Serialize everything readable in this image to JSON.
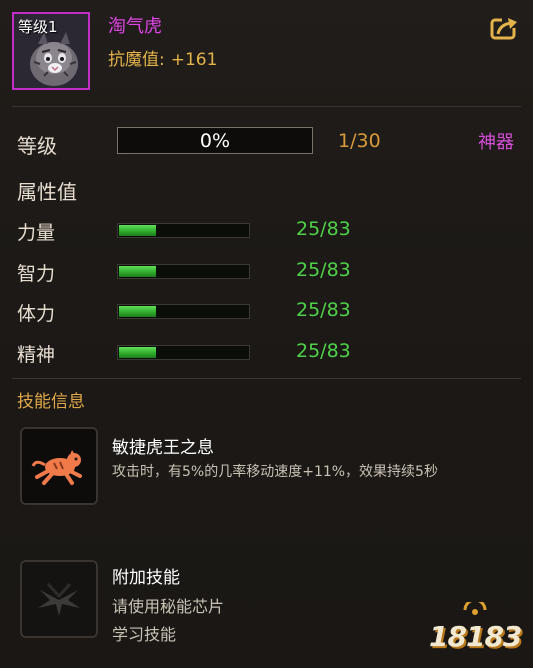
{
  "header": {
    "level_badge": "等级1",
    "pet_name": "淘气虎",
    "resist_label": "抗魔值:",
    "resist_value": "+161"
  },
  "level": {
    "label": "等级",
    "percent_text": "0%",
    "progress": 0,
    "count": "1/30",
    "artifact_label": "神器"
  },
  "attributes": {
    "title": "属性值",
    "items": [
      {
        "name": "力量",
        "value": "25/83",
        "fraction": 0.3
      },
      {
        "name": "智力",
        "value": "25/83",
        "fraction": 0.3
      },
      {
        "name": "体力",
        "value": "25/83",
        "fraction": 0.3
      },
      {
        "name": "精神",
        "value": "25/83",
        "fraction": 0.3
      }
    ]
  },
  "skills": {
    "title": "技能信息",
    "items": [
      {
        "name": "敏捷虎王之息",
        "desc": "攻击时，有5%的几率移动速度+11%，效果持续5秒",
        "icon": "running-tiger-icon"
      },
      {
        "name": "附加技能",
        "desc_line1": "请使用秘能芯片",
        "desc_line2": "学习技能",
        "icon": "locked-skill-icon"
      }
    ]
  },
  "watermark": {
    "text": "18183"
  },
  "colors": {
    "name_purple": "#e044e6",
    "resist_gold": "#e3b24a",
    "bar_green": "#3fc23a",
    "value_green": "#4fd24a",
    "count_orange": "#d89a3c"
  }
}
